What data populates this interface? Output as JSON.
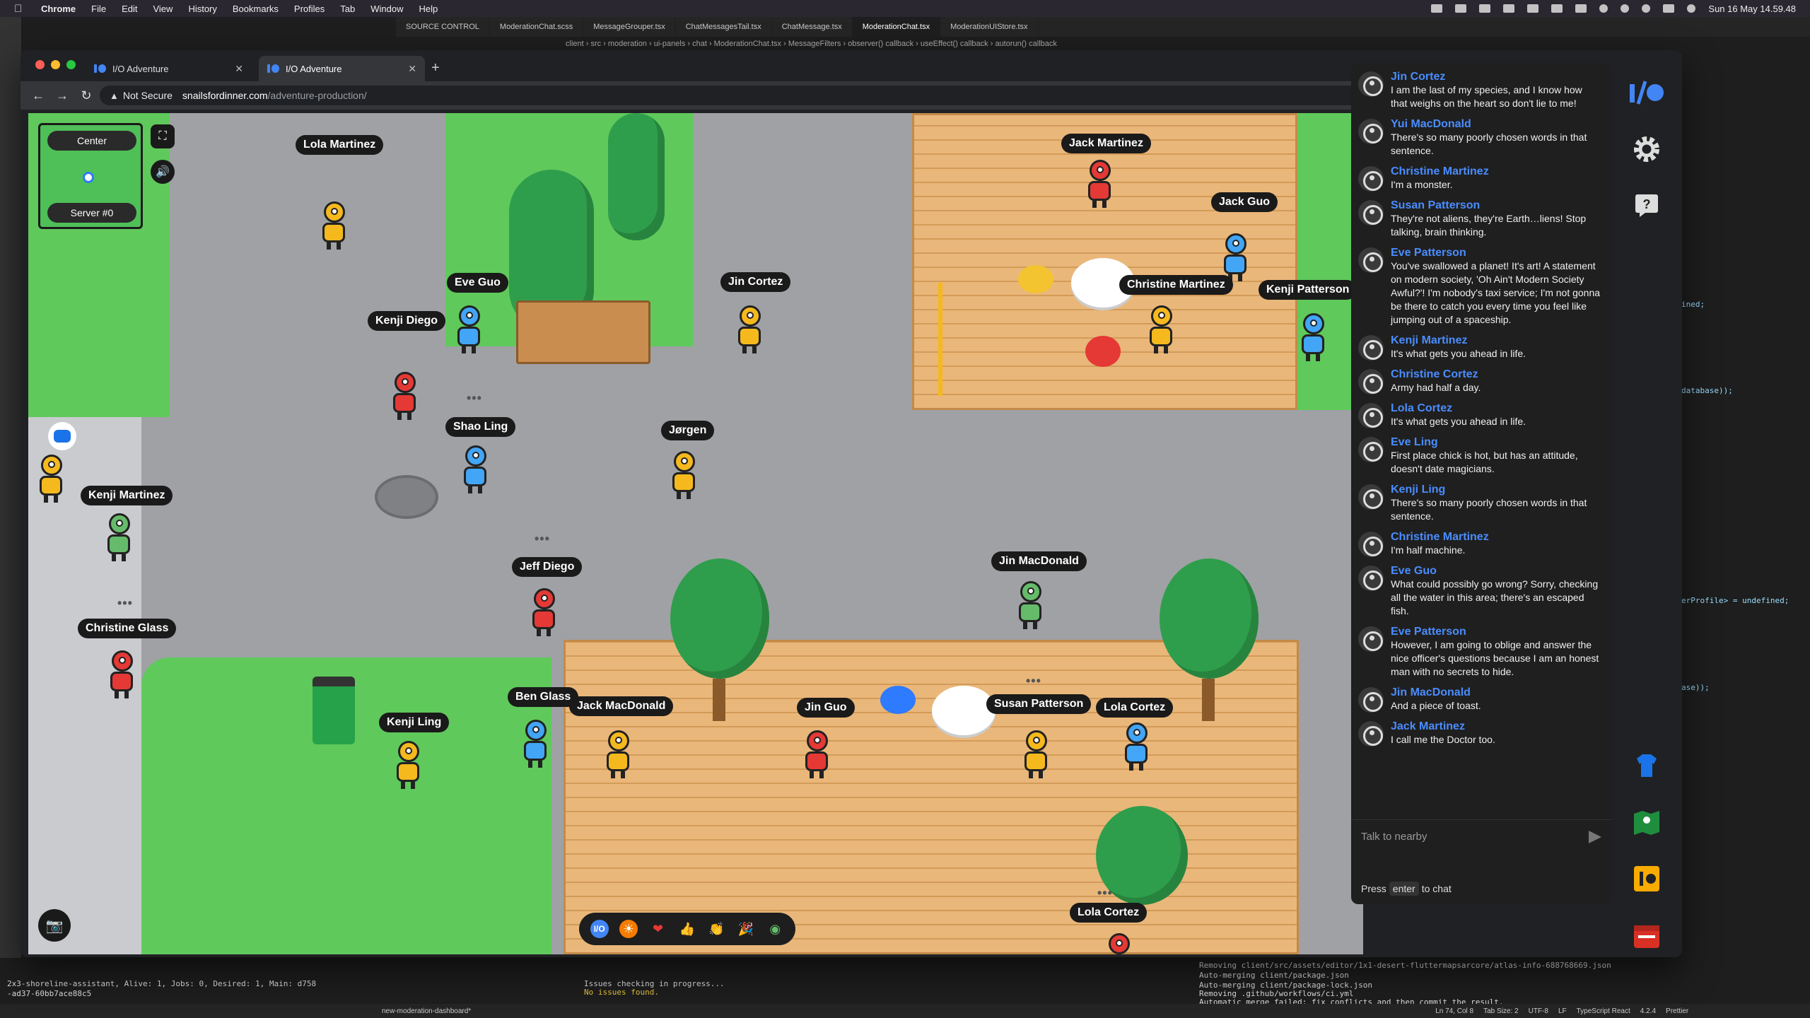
{
  "menubar": {
    "app": "Chrome",
    "items": [
      "File",
      "Edit",
      "View",
      "History",
      "Bookmarks",
      "Profiles",
      "Tab",
      "Window",
      "Help"
    ],
    "clock": "Sun 16 May  14.59.48"
  },
  "ide": {
    "tabs": [
      "SOURCE CONTROL",
      "ModerationChat.scss",
      "MessageGrouper.tsx",
      "ChatMessagesTail.tsx",
      "ChatMessage.tsx",
      "ModerationChat.tsx",
      "ModerationUIStore.tsx"
    ],
    "breadcrumb": "client › src › moderation › ui-panels › chat › ModerationChat.tsx › MessageFilters › observer() callback › useEffect() callback › autorun() callback",
    "code_lines": [
      "ined;",
      "database));",
      "erProfile> = undefined;",
      "ase));"
    ],
    "terminal": [
      "2x3-shoreline-assistant, Alive: 1, Jobs: 0, Desired: 1, Main: d758",
      "-ad37-60bb7ace88c5",
      "Issues checking in progress...",
      "No issues found.",
      "Removing client/src/assets/editor/1x1-desert-fluttermapsarcore/atlas-info-688768669.json",
      "Auto-merging client/package.json",
      "Auto-merging client/package-lock.json",
      "Removing .github/workflows/ci.yml",
      "Automatic merge failed; fix conflicts and then commit the result."
    ],
    "status": [
      "new-moderation-dashboard*",
      "Ln 74, Col 8",
      "Tab Size: 2",
      "UTF-8",
      "LF",
      "TypeScript React",
      "4.2.4",
      "Prettier"
    ]
  },
  "browser": {
    "tabs": [
      {
        "title": "I/O Adventure",
        "active": false
      },
      {
        "title": "I/O Adventure",
        "active": true
      }
    ],
    "security_label": "Not Secure",
    "url_host": "snailsfordinner.com",
    "url_path": "/adventure-production/"
  },
  "game": {
    "controls": {
      "center_label": "Center",
      "server_label": "Server #0"
    },
    "players": [
      {
        "name": "Lola Martinez",
        "color": "#f5b91e"
      },
      {
        "name": "Jack Martinez",
        "color": "#e53935"
      },
      {
        "name": "Jack Guo",
        "color": "#42a5f5"
      },
      {
        "name": "Eve Guo",
        "color": "#42a5f5"
      },
      {
        "name": "Jin Cortez",
        "color": "#f5b91e"
      },
      {
        "name": "Christine Martinez",
        "color": "#f5b91e"
      },
      {
        "name": "Kenji Patterson",
        "color": "#42a5f5"
      },
      {
        "name": "Kenji Diego",
        "color": "#e53935"
      },
      {
        "name": "Shao Ling",
        "color": "#42a5f5"
      },
      {
        "name": "Jørgen",
        "color": "#f5b91e"
      },
      {
        "name": "Kenji Martinez",
        "color": "#66bb6a"
      },
      {
        "name": "Jeff Diego",
        "color": "#e53935"
      },
      {
        "name": "Jin MacDonald",
        "color": "#66bb6a"
      },
      {
        "name": "Christine Glass",
        "color": "#e53935"
      },
      {
        "name": "Ben Glass",
        "color": "#42a5f5"
      },
      {
        "name": "Jack MacDonald",
        "color": "#f5b91e"
      },
      {
        "name": "Jin Guo",
        "color": "#e53935"
      },
      {
        "name": "Susan Patterson",
        "color": "#f5b91e"
      },
      {
        "name": "Lola Cortez",
        "color": "#42a5f5"
      },
      {
        "name": "Kenji Ling",
        "color": "#f5b91e"
      },
      {
        "name": "Lola Cortez",
        "color": "#e53935"
      }
    ],
    "reactions": [
      "io-icon",
      "sun-icon",
      "heart-icon",
      "thumbs-up-icon",
      "clap-icon",
      "party-icon",
      "globe-icon"
    ]
  },
  "chat": {
    "messages": [
      {
        "name": "Jin Cortez",
        "text": "I am the last of my species, and I know how that weighs on the heart so don't lie to me!"
      },
      {
        "name": "Yui MacDonald",
        "text": "There's so many poorly chosen words in that sentence."
      },
      {
        "name": "Christine Martinez",
        "text": "I'm a monster."
      },
      {
        "name": "Susan Patterson",
        "text": "They're not aliens, they're Earth…liens! Stop talking, brain thinking."
      },
      {
        "name": "Eve Patterson",
        "text": "You've swallowed a planet! It's art! A statement on modern society, 'Oh Ain't Modern Society Awful?'! I'm nobody's taxi service; I'm not gonna be there to catch you every time you feel like jumping out of a spaceship."
      },
      {
        "name": "Kenji Martinez",
        "text": "It's what gets you ahead in life."
      },
      {
        "name": "Christine Cortez",
        "text": "Army had half a day."
      },
      {
        "name": "Lola Cortez",
        "text": "It's what gets you ahead in life."
      },
      {
        "name": "Eve Ling",
        "text": "First place chick is hot, but has an attitude, doesn't date magicians."
      },
      {
        "name": "Kenji Ling",
        "text": "There's so many poorly chosen words in that sentence."
      },
      {
        "name": "Christine Martinez",
        "text": "I'm half machine."
      },
      {
        "name": "Eve Guo",
        "text": "What could possibly go wrong? Sorry, checking all the water in this area; there's an escaped fish."
      },
      {
        "name": "Eve Patterson",
        "text": "However, I am going to oblige and answer the nice officer's questions because I am an honest man with no secrets to hide."
      },
      {
        "name": "Jin MacDonald",
        "text": "And a piece of toast."
      },
      {
        "name": "Jack Martinez",
        "text": "I call me the Doctor too."
      }
    ],
    "input_placeholder": "Talk to nearby",
    "hint_prefix": "Press",
    "hint_key": "enter",
    "hint_suffix": "to chat"
  },
  "rail": {
    "icons": [
      "io-logo-icon",
      "settings-gear-icon",
      "help-icon",
      "shirt-icon",
      "map-pin-icon",
      "schedule-icon",
      "calendar-icon"
    ]
  }
}
